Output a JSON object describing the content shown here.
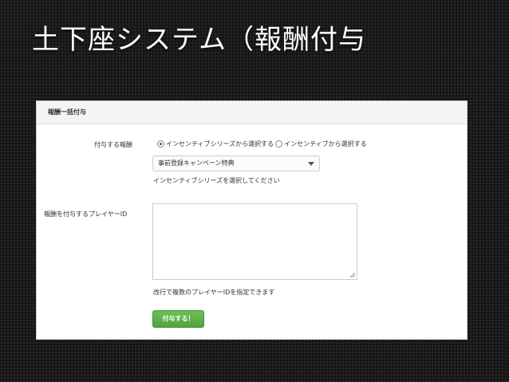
{
  "slide": {
    "title": "土下座システム（報酬付与"
  },
  "panel": {
    "title": "報酬一括付与"
  },
  "form": {
    "reward_label": "付与する報酬",
    "radio_options": [
      {
        "label": "インセンティブシリーズから選択する",
        "checked": true
      },
      {
        "label": "インセンティブから選択する",
        "checked": false
      }
    ],
    "select_value": "事前登録キャンペーン特典",
    "series_help": "インセンティブシリーズを選択してください",
    "player_label": "報酬を付与するプレイヤーID",
    "player_ids_value": "",
    "player_ids_help": "改行で複数のプレイヤーIDを指定できます",
    "submit_label": "付与する！"
  },
  "colors": {
    "submit_button": "#5cb048",
    "background": "#1b1b1b"
  },
  "icons": {
    "select": "chevron-down-icon",
    "textarea": "resize-grip-icon"
  }
}
